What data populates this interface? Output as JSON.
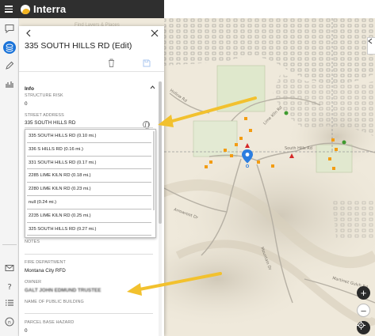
{
  "app": {
    "brand": "Interra",
    "map_search_placeholder": "Find Layers & Places"
  },
  "panel": {
    "title": "335 SOUTH HILLS RD (Edit)",
    "section": "Info",
    "fields": {
      "structure_risk": {
        "label": "STRUCTURE RISK",
        "value": "0"
      },
      "street_address": {
        "label": "STREET ADDRESS",
        "value": "335 SOUTH HILLS RD"
      },
      "notes": {
        "label": "NOTES"
      },
      "fire_department": {
        "label": "FIRE DEPARTMENT",
        "value": "Montana City RFD"
      },
      "owner": {
        "label": "OWNER",
        "value": "GALT JOHN EDMUND TRUSTEE"
      },
      "public_building": {
        "label": "NAME OF PUBLIC BUILDING"
      },
      "parcel_base_hazard": {
        "label": "PARCEL BASE HAZARD",
        "value": "0"
      }
    },
    "address_suggestions": [
      "335 SOUTH HILLS RD (0.10 mi.)",
      "336 S HILLS RD (0.16 mi.)",
      "331 SOUTH HILLS RD (0.17 mi.)",
      "2285 LIME KILN RD (0.18 mi.)",
      "2280 LIME KILN RD (0.23 mi.)",
      "null (0.24 mi.)",
      "2235 LIME KILN RD (0.25 mi.)",
      "325 SOUTH HILLS RD (0.27 mi.)"
    ]
  },
  "map": {
    "road_labels": {
      "south_hills_rd": "South Hills Rd",
      "arrowroot_dr": "Arrowroot Dr",
      "mountain_dr": "Mountain Dr",
      "martinez_gulch_rd": "Martinez Gulch Rd",
      "hollow_rd": "Hollow Rd",
      "lime_kiln_rd": "Lime Kiln Rd"
    },
    "zoom_in": "+",
    "zoom_out": "−"
  },
  "icons": {
    "rail_top": [
      "comment-icon",
      "layers-icon",
      "pencil-icon",
      "analytics-icon"
    ],
    "rail_bottom": [
      "mail-icon",
      "help-icon",
      "list-icon",
      "user-icon"
    ]
  },
  "colors": {
    "topbar": "#2f2f2f",
    "brand_accent": "#f2b320",
    "active_rail": "#1a73d9",
    "arrow": "#f2c12e",
    "map_marker": "#2b7de0",
    "poi_orange": "#f39c12",
    "poi_red": "#d62828",
    "poi_green": "#3f9b2f"
  }
}
